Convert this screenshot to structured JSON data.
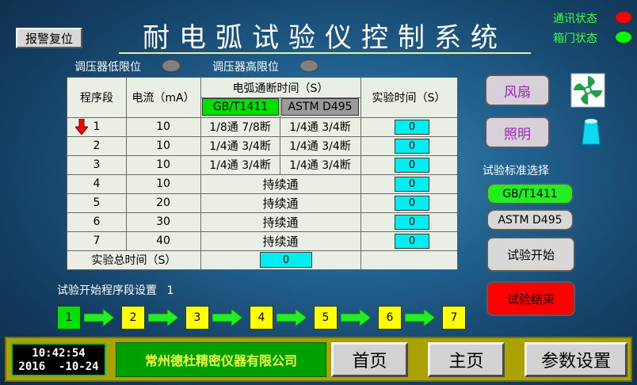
{
  "header": {
    "alarm_reset_label": "报警复位",
    "title": "耐电弧试验仪控制系统",
    "comm_status_label": "通讯状态",
    "door_status_label": "箱门状态",
    "comm_status_color": "#ff0000",
    "door_status_color": "#00ff00"
  },
  "limits": {
    "low_label": "调压器低限位",
    "high_label": "调压器高限位"
  },
  "table": {
    "col_step": "程序段",
    "col_current": "电流（mA）",
    "col_arc_time": "电弧通断时间（S）",
    "col_gb": "GB/T1411",
    "col_astm": "ASTM D495",
    "col_test_time": "实验时间（S）",
    "rows": [
      {
        "step": "1",
        "current": "10",
        "gb": "1/8通 7/8断",
        "astm": "1/4通 3/4断",
        "time": "0"
      },
      {
        "step": "2",
        "current": "10",
        "gb": "1/4通 3/4断",
        "astm": "1/4通 3/4断",
        "time": "0"
      },
      {
        "step": "3",
        "current": "10",
        "gb": "1/4通 3/4断",
        "astm": "1/4通 3/4断",
        "time": "0"
      },
      {
        "step": "4",
        "current": "10",
        "merged": "持续通",
        "time": "0"
      },
      {
        "step": "5",
        "current": "20",
        "merged": "持续通",
        "time": "0"
      },
      {
        "step": "6",
        "current": "30",
        "merged": "持续通",
        "time": "0"
      },
      {
        "step": "7",
        "current": "40",
        "merged": "持续通",
        "time": "0"
      }
    ],
    "total_label": "实验总时间（S）",
    "total_value": "0",
    "current_step_arrow_color": "#ff0000"
  },
  "steps": {
    "label": "试验开始程序段设置",
    "value": "1",
    "items": [
      "1",
      "2",
      "3",
      "4",
      "5",
      "6",
      "7"
    ],
    "active_index": 0,
    "active_color": "#00e000",
    "inactive_color": "#ffff00",
    "arrow_color": "#22ee22"
  },
  "controls": {
    "fan_label": "风扇",
    "light_label": "照明",
    "fan_icon": "fan-icon",
    "light_icon": "lamp-icon",
    "standard_select_label": "试验标准选择",
    "standard_gb": "GB/T1411",
    "standard_astm": "ASTM D495",
    "selected_standard_color": "#22ee22",
    "start_label": "试验开始",
    "end_label": "试验结束",
    "end_color": "#ff0000"
  },
  "footer": {
    "time": "10:42:54",
    "date": "2016  -10-24",
    "company": "常州德杜精密仪器有限公司",
    "home_label": "首页",
    "main_label": "主页",
    "settings_label": "参数设置"
  }
}
